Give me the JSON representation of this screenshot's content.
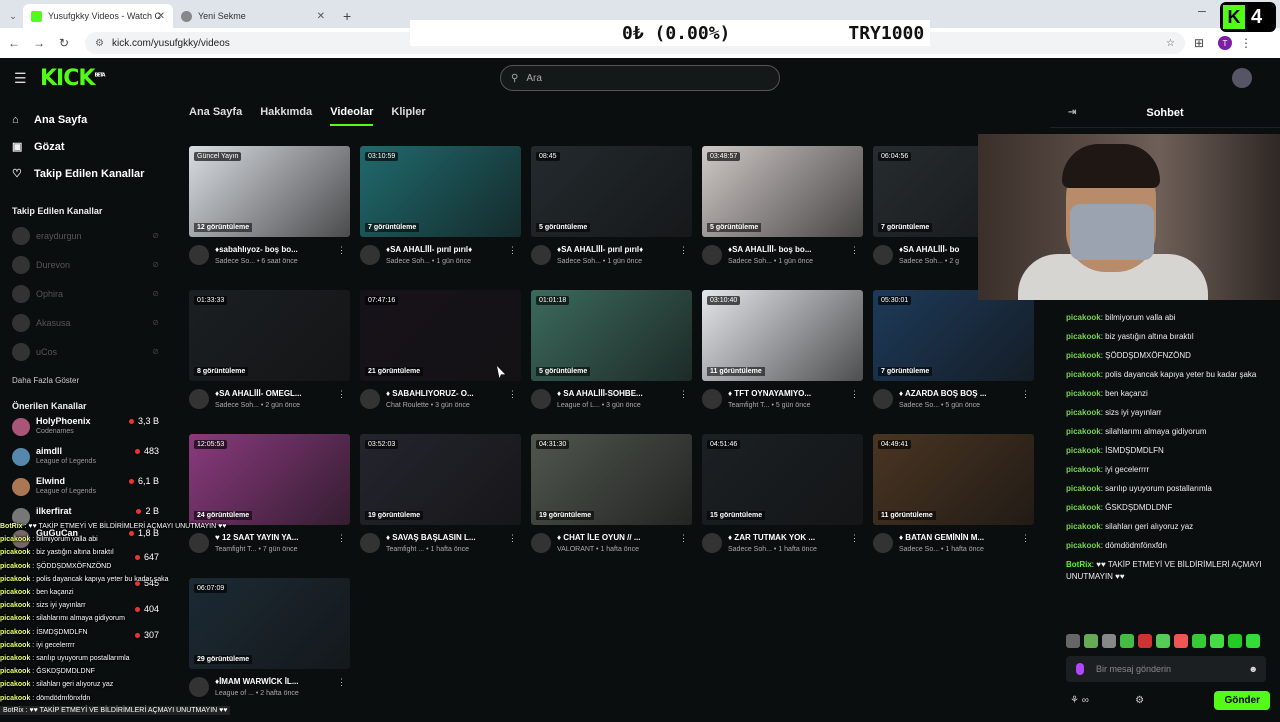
{
  "browser": {
    "tabs": [
      {
        "title": "Yusufgkky Videos - Watch C",
        "active": true
      },
      {
        "title": "Yeni Sekme",
        "active": false
      }
    ],
    "url": "kick.com/yusufgkky/videos",
    "ticker_left": "0₺ (0.00%)",
    "ticker_right": "TRY1000",
    "badge_number": "4"
  },
  "header": {
    "logo": "KICK",
    "logo_tag": "BETA",
    "search_placeholder": "Ara"
  },
  "sidebar": {
    "nav": [
      {
        "label": "Ana Sayfa",
        "icon": "home-icon"
      },
      {
        "label": "Gözat",
        "icon": "browse-icon"
      },
      {
        "label": "Takip Edilen Kanallar",
        "icon": "heart-icon"
      }
    ],
    "followed_heading": "Takip Edilen Kanallar",
    "followed": [
      "eraydurgun",
      "Durevon",
      "Ophira",
      "Akasusa",
      "uCos"
    ],
    "show_more": "Daha Fazla Göster",
    "recommended_heading": "Önerilen Kanallar",
    "recommended": [
      {
        "name": "HolyPhoenix",
        "category": "Codenames",
        "viewers": "3,3 B"
      },
      {
        "name": "aimdll",
        "category": "League of Legends",
        "viewers": "483"
      },
      {
        "name": "Elwind",
        "category": "League of Legends",
        "viewers": "6,1 B"
      },
      {
        "name": "ilkerfirat",
        "category": "",
        "viewers": "2 B"
      },
      {
        "name": "GuGuCan",
        "category": "",
        "viewers": "1,8 B"
      },
      {
        "name": "",
        "category": "",
        "viewers": "647"
      },
      {
        "name": "",
        "category": "",
        "viewers": "545"
      },
      {
        "name": "",
        "category": "",
        "viewers": "404"
      },
      {
        "name": "",
        "category": "",
        "viewers": "307"
      }
    ]
  },
  "content": {
    "tabs": [
      "Ana Sayfa",
      "Hakkımda",
      "Videolar",
      "Klipler"
    ],
    "active_tab": "Videolar",
    "videos": [
      {
        "duration": "Güncel Yayın",
        "views": "12 görüntüleme",
        "title": "♦sabahlıyoz- boş bo...",
        "sub": "Sadece So... • 6 saat önce",
        "color": "#d9dde2"
      },
      {
        "duration": "03:10:59",
        "views": "7 görüntüleme",
        "title": "♦SA AHALİİİ- pırıl pırıl♦",
        "sub": "Sadece Soh... • 1 gün önce",
        "color": "#1f6a6e"
      },
      {
        "duration": "08:45",
        "views": "5 görüntüleme",
        "title": "♦SA AHALİİİ- pırıl pırıl♦",
        "sub": "Sadece Soh... • 1 gün önce",
        "color": "#232a2e"
      },
      {
        "duration": "03:48:57",
        "views": "5 görüntüleme",
        "title": "♦SA AHALİİİ- boş bo...",
        "sub": "Sadece Soh... • 1 gün önce",
        "color": "#cfc8c6"
      },
      {
        "duration": "06:04:56",
        "views": "7 görüntüleme",
        "title": "♦SA AHALİİİ- bo",
        "sub": "Sadece Soh... • 2 g",
        "color": "#262c2f"
      },
      {
        "duration": "01:33:33",
        "views": "8 görüntüleme",
        "title": "♦SA AHALİİİ- OMEGL...",
        "sub": "Sadece Soh... • 2 gün önce",
        "color": "#1b1f22"
      },
      {
        "duration": "07:47:16",
        "views": "21 görüntüleme",
        "title": "♦ SABAHLIYORUZ- O...",
        "sub": "Chat Roulette • 3 gün önce",
        "color": "#17121a"
      },
      {
        "duration": "01:01:18",
        "views": "5 görüntüleme",
        "title": "♦ SA AHALİİİ-SOHBE...",
        "sub": "League of L... • 3 gün önce",
        "color": "#3b6a5c"
      },
      {
        "duration": "03:10:40",
        "views": "11 görüntüleme",
        "title": "♦ TFT OYNAYAMIYO...",
        "sub": "Teamfight T... • 5 gün önce",
        "color": "#e3e6ea"
      },
      {
        "duration": "05:30:01",
        "views": "7 görüntüleme",
        "title": "♦ AZARDA BOŞ BOŞ ...",
        "sub": "Sadece So... • 5 gün önce",
        "color": "#1d3a5a"
      },
      {
        "duration": "12:05:53",
        "views": "24 görüntüleme",
        "title": "♥ 12 SAAT YAYIN YA...",
        "sub": "Teamfight T... • 7 gün önce",
        "color": "#8a3a7e"
      },
      {
        "duration": "03:52:03",
        "views": "19 görüntüleme",
        "title": "♦ SAVAŞ BAŞLASIN L...",
        "sub": "Teamfight ... • 1 hafta önce",
        "color": "#24242e"
      },
      {
        "duration": "04:31:30",
        "views": "19 görüntüleme",
        "title": "♦ CHAT İLE OYUN // ...",
        "sub": "VALORANT • 1 hafta önce",
        "color": "#50564e"
      },
      {
        "duration": "04:51:46",
        "views": "15 görüntüleme",
        "title": "♦ ZAR TUTMAK YOK ...",
        "sub": "Sadece Soh... • 1 hafta önce",
        "color": "#1b2024"
      },
      {
        "duration": "04:49:41",
        "views": "11 görüntüleme",
        "title": "♦ BATAN GEMİNİN M...",
        "sub": "Sadece So... • 1 hafta önce",
        "color": "#4a3522"
      },
      {
        "duration": "06:07:09",
        "views": "29 görüntüleme",
        "title": "♦İMAM WARWİCK İL...",
        "sub": "League of ... • 2 hafta önce",
        "color": "#1c2a34"
      }
    ]
  },
  "chat": {
    "title": "Sohbet",
    "messages": [
      {
        "user": "picakook",
        "text": "bilmiyorum valla abi"
      },
      {
        "user": "picakook",
        "text": "biz yastığın altına bıraktıl"
      },
      {
        "user": "picakook",
        "text": "ŞÖDDŞDMXÖFNZÖND"
      },
      {
        "user": "picakook",
        "text": "polis dayancak kapıya yeter bu kadar şaka"
      },
      {
        "user": "picakook",
        "text": "ben kaçanzi"
      },
      {
        "user": "picakook",
        "text": "sizs iyi yayınlarr"
      },
      {
        "user": "picakook",
        "text": "silahlarımı almaya gidiyorum"
      },
      {
        "user": "picakook",
        "text": "İSMDŞDMDLFN"
      },
      {
        "user": "picakook",
        "text": "iyi gecelerrrr"
      },
      {
        "user": "picakook",
        "text": "sarılıp uyuyorum postallarımla"
      },
      {
        "user": "picakook",
        "text": "ĞSKDŞDMDLDNF"
      },
      {
        "user": "picakook",
        "text": "silahları geri alıyoruz yaz"
      },
      {
        "user": "picakook",
        "text": "dömdödmfönxfdn"
      },
      {
        "user": "BotRix",
        "text": "♥♥ TAKİP ETMEYİ VE BİLDİRİMLERİ AÇMAYI UNUTMAYIN ♥♥"
      }
    ],
    "input_placeholder": "Bir mesaj gönderin",
    "send_label": "Gönder"
  },
  "overlay": {
    "lines": [
      {
        "user": "BotRix",
        "text": "♥♥ TAKİP ETMEYİ VE BİLDİRİMLERİ AÇMAYI UNUTMAYIN ♥♥"
      },
      {
        "user": "picakook",
        "text": "bilmiyorum valla abi"
      },
      {
        "user": "picakook",
        "text": "biz yastığın altına bıraktıl"
      },
      {
        "user": "picakook",
        "text": "ŞÖDDŞDMXÖFNZÖND"
      },
      {
        "user": "picakook",
        "text": "polis dayancak kapıya yeter bu kadar şaka"
      },
      {
        "user": "picakook",
        "text": "ben kaçanzi"
      },
      {
        "user": "picakook",
        "text": "sizs iyi yayınlarr"
      },
      {
        "user": "picakook",
        "text": "silahlarımı almaya gidiyorum"
      },
      {
        "user": "picakook",
        "text": "İSMDŞDMDLFN"
      },
      {
        "user": "picakook",
        "text": "iyi gecelerrrr"
      },
      {
        "user": "picakook",
        "text": "sarılıp uyuyorum postallarımla"
      },
      {
        "user": "picakook",
        "text": "ĞSKDŞDMDLDNF"
      },
      {
        "user": "picakook",
        "text": "silahları geri alıyoruz yaz"
      },
      {
        "user": "picakook",
        "text": "dömdödmfönxfdn"
      }
    ],
    "bottom": "BotRix : ♥♥ TAKİP ETMEYİ VE BİLDİRİMLERİ AÇMAYI UNUTMAYIN ♥♥"
  },
  "colors": {
    "accent": "#53fc18",
    "bg": "#0b0e0f"
  }
}
